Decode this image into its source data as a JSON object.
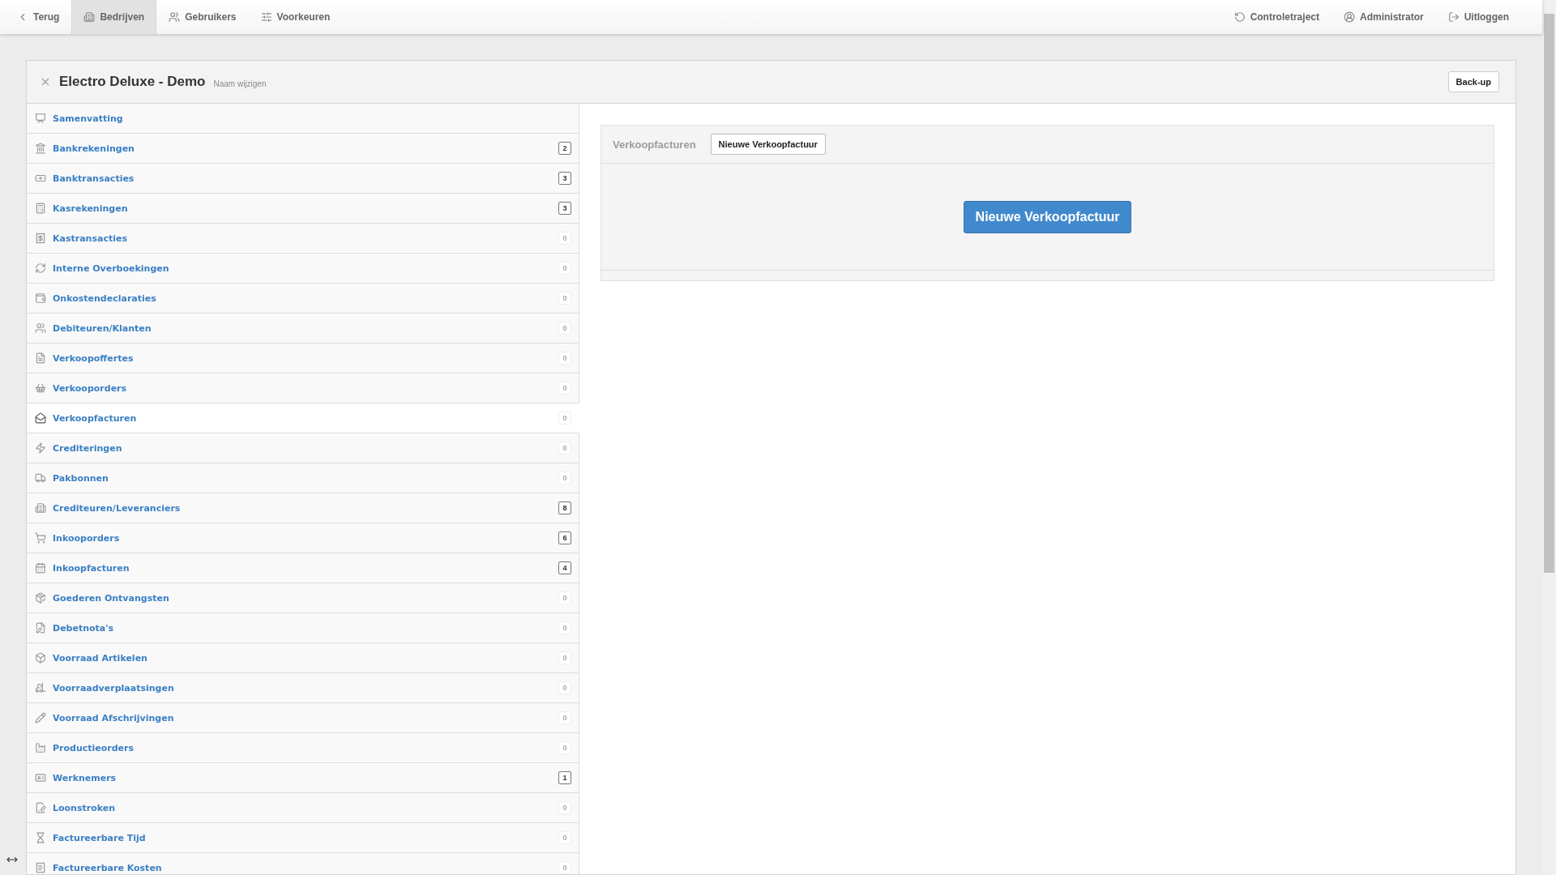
{
  "topbar": {
    "left": [
      {
        "label": "Terug",
        "kind": "back",
        "selected": false
      },
      {
        "label": "Bedrijven",
        "kind": "companies",
        "selected": true
      },
      {
        "label": "Gebruikers",
        "kind": "users",
        "selected": false
      },
      {
        "label": "Voorkeuren",
        "kind": "preferences",
        "selected": false
      }
    ],
    "right": [
      {
        "label": "Controletraject",
        "kind": "audit"
      },
      {
        "label": "Administrator",
        "kind": "user"
      },
      {
        "label": "Uitloggen",
        "kind": "logout"
      }
    ]
  },
  "company": {
    "title": "Electro Deluxe - Demo",
    "rename_link": "Naam wijzigen",
    "backup_button": "Back-up"
  },
  "sidebar": {
    "items": [
      {
        "label": "Samenvatting",
        "selected": false
      },
      {
        "label": "Bankrekeningen",
        "count": "2",
        "muted": false,
        "selected": false
      },
      {
        "label": "Banktransacties",
        "count": "3",
        "muted": false,
        "selected": false
      },
      {
        "label": "Kasrekeningen",
        "count": "3",
        "muted": false,
        "selected": false
      },
      {
        "label": "Kastransacties",
        "count": "0",
        "muted": true,
        "selected": false
      },
      {
        "label": "Interne Overboekingen",
        "count": "0",
        "muted": true,
        "selected": false
      },
      {
        "label": "Onkostendeclaraties",
        "count": "0",
        "muted": true,
        "selected": false
      },
      {
        "label": "Debiteuren/Klanten",
        "count": "0",
        "muted": true,
        "selected": false
      },
      {
        "label": "Verkoopoffertes",
        "count": "0",
        "muted": true,
        "selected": false
      },
      {
        "label": "Verkooporders",
        "count": "0",
        "muted": true,
        "selected": false
      },
      {
        "label": "Verkoopfacturen",
        "count": "0",
        "muted": true,
        "selected": true
      },
      {
        "label": "Crediteringen",
        "count": "0",
        "muted": true,
        "selected": false
      },
      {
        "label": "Pakbonnen",
        "count": "0",
        "muted": true,
        "selected": false
      },
      {
        "label": "Crediteuren/Leveranciers",
        "count": "8",
        "muted": false,
        "selected": false
      },
      {
        "label": "Inkooporders",
        "count": "6",
        "muted": false,
        "selected": false
      },
      {
        "label": "Inkoopfacturen",
        "count": "4",
        "muted": false,
        "selected": false
      },
      {
        "label": "Goederen Ontvangsten",
        "count": "0",
        "muted": true,
        "selected": false
      },
      {
        "label": "Debetnota's",
        "count": "0",
        "muted": true,
        "selected": false
      },
      {
        "label": "Voorraad Artikelen",
        "count": "0",
        "muted": true,
        "selected": false
      },
      {
        "label": "Voorraadverplaatsingen",
        "count": "0",
        "muted": true,
        "selected": false
      },
      {
        "label": "Voorraad Afschrijvingen",
        "count": "0",
        "muted": true,
        "selected": false
      },
      {
        "label": "Productieorders",
        "count": "0",
        "muted": true,
        "selected": false
      },
      {
        "label": "Werknemers",
        "count": "1",
        "muted": false,
        "selected": false
      },
      {
        "label": "Loonstroken",
        "count": "0",
        "muted": true,
        "selected": false
      },
      {
        "label": "Factureerbare Tijd",
        "count": "0",
        "muted": true,
        "selected": false
      },
      {
        "label": "Factureerbare Kosten",
        "count": "0",
        "muted": true,
        "selected": false
      }
    ]
  },
  "panel": {
    "title": "Verkoopfacturen",
    "header_button": "Nieuwe Verkoopfactuur",
    "main_button": "Nieuwe Verkoopfactuur"
  }
}
